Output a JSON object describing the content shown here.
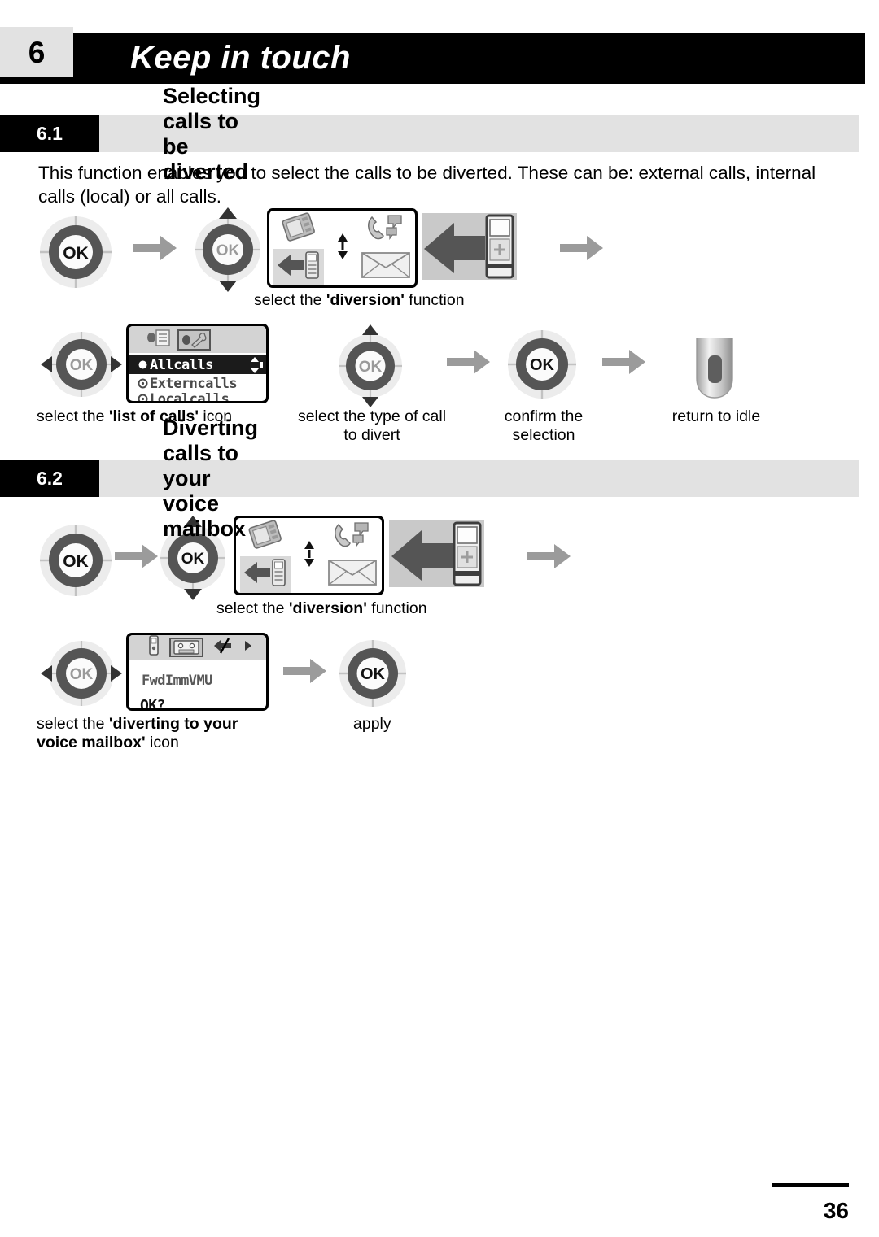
{
  "chapter": {
    "number": "6",
    "title": "Keep in touch"
  },
  "sections": [
    {
      "number": "6.1",
      "title": "Selecting calls to be diverted",
      "intro": "This function enables you to select the calls to be diverted. These can be: external calls, internal calls (local) or all calls.",
      "captions": {
        "diversion": {
          "pre": "select the ",
          "bold": "'diversion'",
          "post": " function"
        },
        "list_of_calls": {
          "pre": "select the ",
          "bold": "'list of calls'",
          "post": " icon"
        },
        "type_of_call_l1": "select the type of call",
        "type_of_call_l2": "to divert",
        "confirm_l1": "confirm the",
        "confirm_l2": "selection",
        "return_idle": "return to idle"
      },
      "list_screen": {
        "tabs": [
          "contacts-list-icon",
          "settings-wrench-icon"
        ],
        "selected_tab_index": 1,
        "items": [
          {
            "label": "Allcalls",
            "selected": true
          },
          {
            "label": "Externcalls",
            "selected": false
          },
          {
            "label": "Localcalls",
            "selected": false
          }
        ]
      }
    },
    {
      "number": "6.2",
      "title": "Diverting calls to your voice mailbox",
      "captions": {
        "diversion": {
          "pre": "select the ",
          "bold": "'diversion'",
          "post": " function"
        },
        "divert_vm_l1_pre": "select the ",
        "divert_vm_l1_bold": "'diverting to your",
        "divert_vm_l2_bold": "voice mailbox'",
        "divert_vm_l2_post": " icon",
        "apply": "apply"
      },
      "vm_screen": {
        "tabs": [
          "handset-icon",
          "voicemail-cassette-icon",
          "diversion-cancel-icon",
          "next-arrow-icon"
        ],
        "selected_tab_index": 1,
        "line1": "FwdImmVMU",
        "line2": "OK?"
      }
    }
  ],
  "home_screen": {
    "icons": [
      "device-icon",
      "handset-calls-icon",
      "diversion-arrow-icon",
      "envelope-icon"
    ],
    "scroll_indicator": "up-down-arrows-icon",
    "highlighted_icon": "diversion-arrow-icon"
  },
  "keys": {
    "ok_label": "OK"
  },
  "footer": {
    "page_number": "36"
  },
  "colors": {
    "bar_black": "#000000",
    "band_gray": "#e2e2e2",
    "arrow_gray": "#9b9b9b",
    "wheel_dark": "#555555",
    "wheel_light": "#e8e8e8"
  }
}
